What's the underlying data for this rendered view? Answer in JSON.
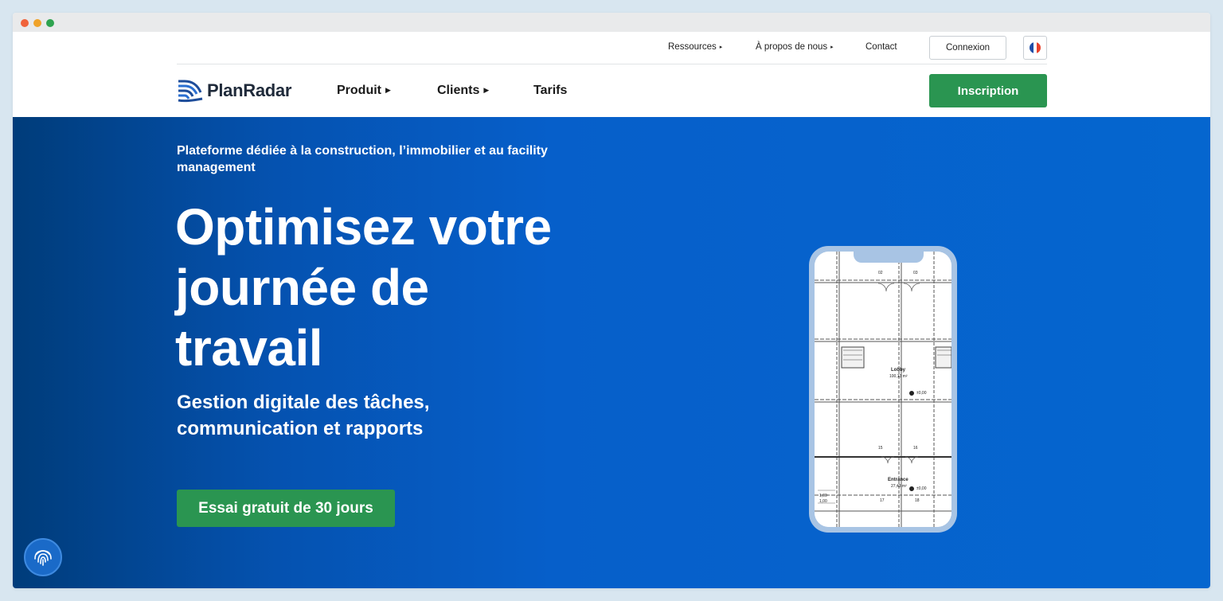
{
  "utility_nav": {
    "resources": "Ressources",
    "about": "À propos de nous",
    "contact": "Contact",
    "login": "Connexion",
    "language_flag": "flag-fr-icon"
  },
  "main_nav": {
    "logo_text": "PlanRadar",
    "product": "Produit",
    "clients": "Clients",
    "pricing": "Tarifs",
    "signup": "Inscription"
  },
  "hero": {
    "eyebrow": "Plateforme dédiée à la construction, l’immobilier et au facility management",
    "headline_line1": "Optimisez votre",
    "headline_line2": "journée de",
    "headline_line3": "travail",
    "subhead_line1": "Gestion digitale des tâches,",
    "subhead_line2": "communication et rapports",
    "cta": "Essai gratuit de 30 jours"
  },
  "floor_plan": {
    "room_top_left": "02",
    "room_top_right": "03",
    "lobby_label": "Lobby",
    "lobby_area": "100,13 m²",
    "elevation_1": "±0,00",
    "room_mid_left": "15",
    "room_mid_right": "16",
    "entrance_label": "Entrance",
    "entrance_area": "27,43 m²",
    "elevation_2": "±0,00",
    "dim_1": "1,00",
    "dim_2": "1,00",
    "room_bottom_left": "17",
    "room_bottom_right": "18"
  },
  "colors": {
    "brand_green": "#2a9551",
    "hero_blue_dark": "#003c7a",
    "hero_blue": "#0566cf",
    "phone_frame": "#a8c4e4"
  }
}
